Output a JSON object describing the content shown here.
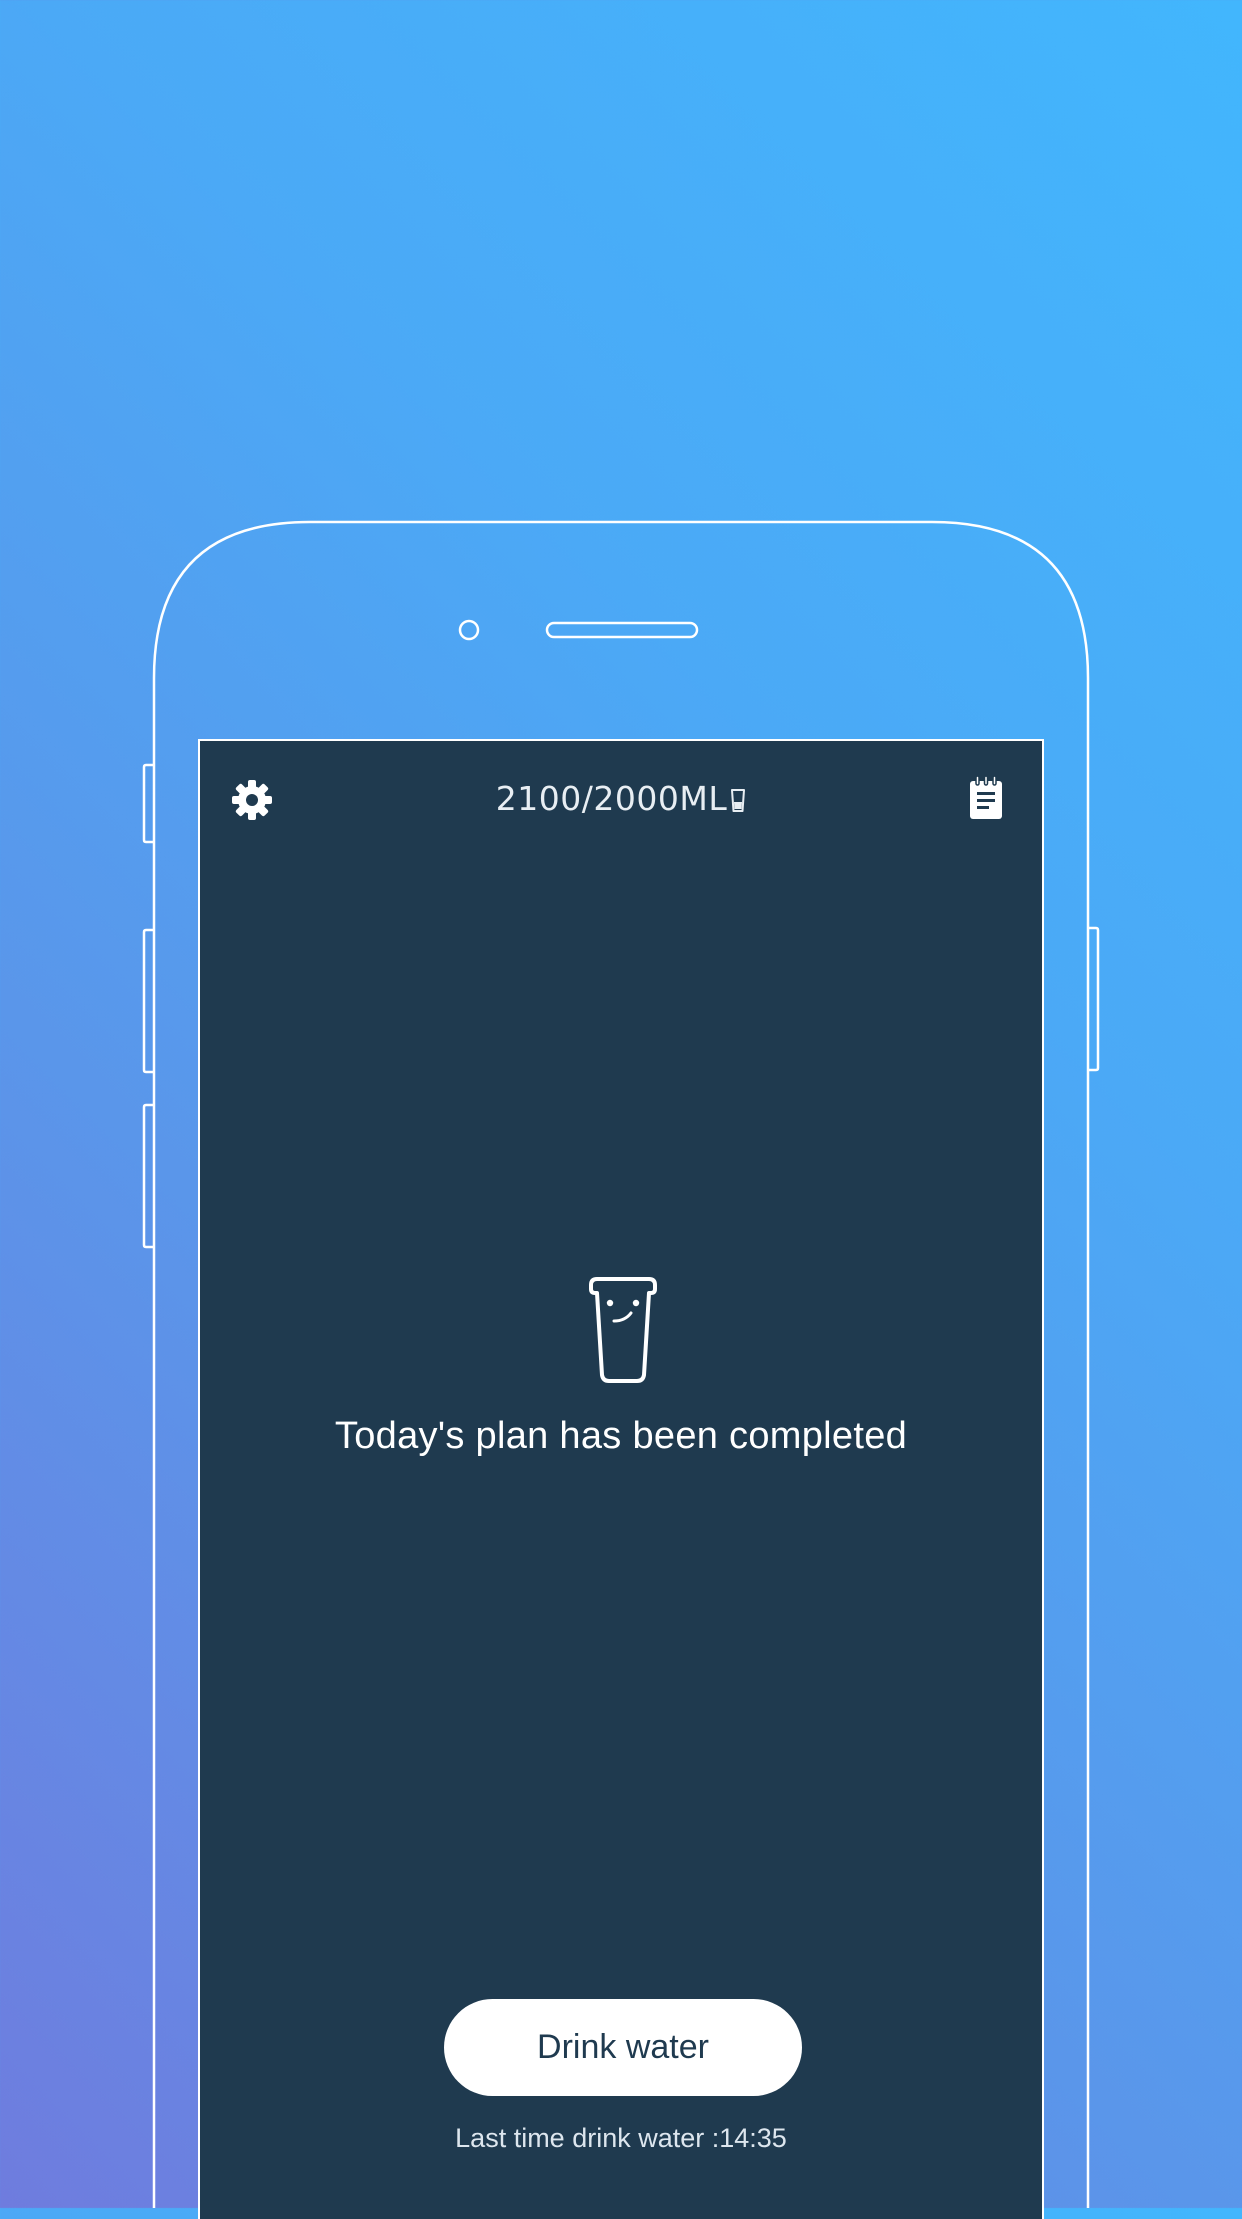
{
  "header": {
    "intake_label": "2100/2000ML",
    "settings_icon": "gear-icon",
    "record_icon": "notepad-icon",
    "cup_icon": "cup-icon"
  },
  "main": {
    "mascot_icon": "smiling-cup-icon",
    "status_message": "Today's plan has been completed"
  },
  "footer": {
    "drink_button_label": "Drink water",
    "last_time_label": "Last time drink water :14:35"
  },
  "colors": {
    "background_top": "#42b6fd",
    "background_bottom": "#6f7cde",
    "screen": "#1f3a4f",
    "button": "#ffffff"
  }
}
